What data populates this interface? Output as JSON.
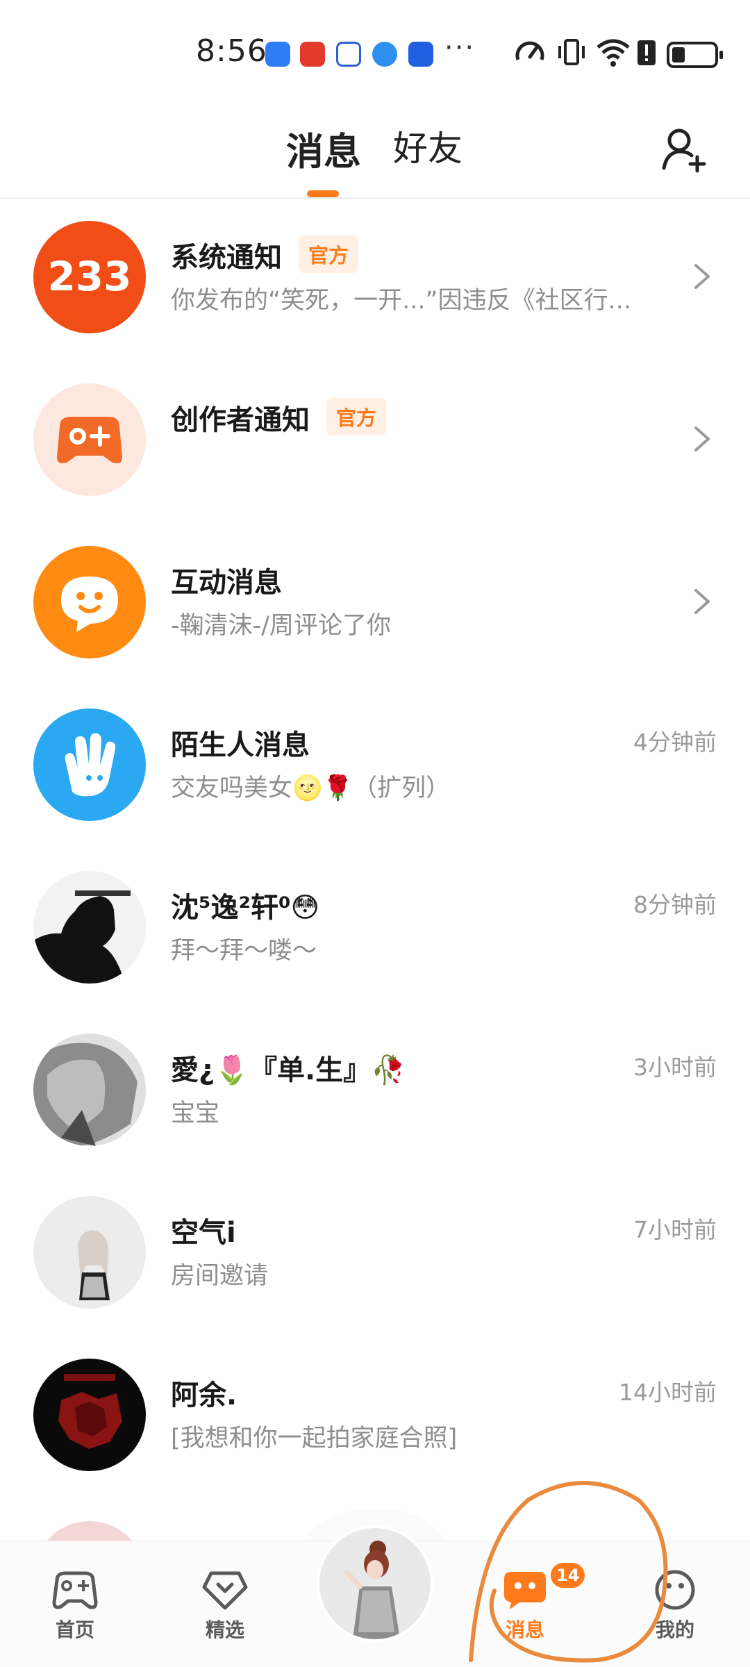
{
  "status_bar": {
    "time": "8:56",
    "more": "···"
  },
  "header": {
    "tabs": [
      {
        "label": "消息",
        "active": true
      },
      {
        "label": "好友",
        "active": false
      }
    ],
    "add_friend_icon": "add-user-icon"
  },
  "messages": [
    {
      "name": "系统通知",
      "badge": "官方",
      "preview": "你发布的“笑死，一开...”因违反《社区行...",
      "time": "",
      "icon": "233-logo",
      "chevron": true
    },
    {
      "name": "创作者通知",
      "badge": "官方",
      "preview": "",
      "time": "",
      "icon": "gamepad-icon",
      "chevron": true
    },
    {
      "name": "互动消息",
      "badge": "",
      "preview": "-鞠清沫-/周评论了你",
      "time": "",
      "icon": "chat-smile-icon",
      "chevron": true
    },
    {
      "name": "陌生人消息",
      "badge": "",
      "preview": "交友吗美女🌝🌹（扩列）",
      "time": "4分钟前",
      "icon": "wave-hand-icon",
      "chevron": false
    },
    {
      "name": "沈⁵逸²轩⁰😳",
      "badge": "",
      "preview": "拜～拜～喽～",
      "time": "8分钟前",
      "icon": "avatar-silhouette",
      "chevron": false
    },
    {
      "name": "愛¿🌷『单.生』🥀",
      "badge": "",
      "preview": "宝宝",
      "time": "3小时前",
      "icon": "avatar-grey-hair",
      "chevron": false
    },
    {
      "name": "空气i",
      "badge": "",
      "preview": "房间邀请",
      "time": "7小时前",
      "icon": "avatar-doll",
      "chevron": false
    },
    {
      "name": "阿余.",
      "badge": "",
      "preview": "[我想和你一起拍家庭合照]",
      "time": "14小时前",
      "icon": "avatar-red-dark",
      "chevron": false
    }
  ],
  "bottom_nav": {
    "items": [
      {
        "label": "首页",
        "icon": "gamepad-icon",
        "active": false
      },
      {
        "label": "精选",
        "icon": "heart-tag-icon",
        "active": false
      },
      {
        "label": "",
        "icon": "center-avatar",
        "active": false
      },
      {
        "label": "消息",
        "icon": "message-icon",
        "active": true,
        "badge": "14"
      },
      {
        "label": "我的",
        "icon": "smile-icon",
        "active": false
      }
    ]
  },
  "colors": {
    "accent": "#ff7a1a",
    "blue": "#2aa8f2",
    "grey_text": "#8e8e8e"
  }
}
